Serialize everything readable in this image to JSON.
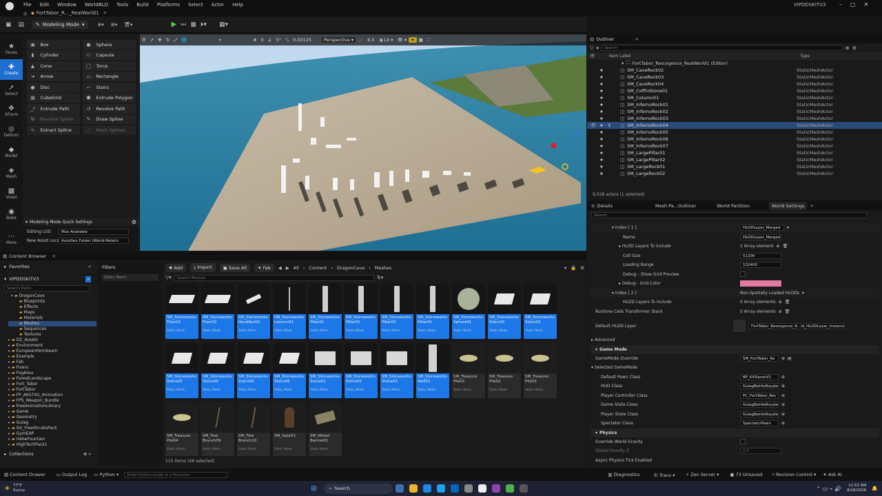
{
  "title_bar": {
    "menus": [
      "File",
      "Edit",
      "Window",
      "WorldBLD",
      "Tools",
      "Build",
      "Platforms",
      "Select",
      "Actor",
      "Help"
    ],
    "tab": "FortTabor_R..._RealWorld1",
    "project": "VIPDDSKITV3"
  },
  "toolbar": {
    "mode": "Modeling Mode"
  },
  "left_icons": [
    {
      "label": "Faves",
      "icon": "star-icon"
    },
    {
      "label": "Create",
      "icon": "plus-icon"
    },
    {
      "label": "Select",
      "icon": "cursor-icon"
    },
    {
      "label": "XForm",
      "icon": "transform-icon"
    },
    {
      "label": "Deform",
      "icon": "deform-icon"
    },
    {
      "label": "Model",
      "icon": "cube-icon"
    },
    {
      "label": "Mesh",
      "icon": "mesh-icon"
    },
    {
      "label": "Voxel",
      "icon": "voxel-icon"
    },
    {
      "label": "Bake",
      "icon": "bake-icon"
    },
    {
      "label": "More",
      "icon": "more-icon"
    }
  ],
  "tools_left": [
    "Box",
    "Cylinder",
    "Cone",
    "Arrow",
    "Disc",
    "CubeGrid",
    "Extrude Path",
    "Revolve Spline",
    "Extract Spline"
  ],
  "tools_right": [
    "Sphere",
    "Capsule",
    "Torus",
    "Rectangle",
    "Stairs",
    "Extrude Polygon",
    "Revolve Path",
    "Draw Spline",
    "Mesh Splines"
  ],
  "quick_settings": {
    "title": "Modeling Mode Quick Settings",
    "editing_lod_label": "Editing LOD",
    "editing_lod_value": "Max Available",
    "new_asset_label": "New Asset Locatio",
    "new_asset_value": "AutoGen Folder (World-Relativ"
  },
  "viewport": {
    "perspective": "Perspective",
    "lit": "Lit",
    "snap_value": "0.03125",
    "camera_speed": "6.5",
    "grid": "0",
    "angle": "5°",
    "scale": "1"
  },
  "outliner": {
    "title": "Outliner",
    "search_placeholder": "Search",
    "col_label": "Item Label",
    "col_type": "Type",
    "root": "FortTabor_Resurgence_RealWorld1 (Editor)",
    "items": [
      "SM_CaveRock02",
      "SM_CaveRock03",
      "SM_CaveRock04",
      "SM_CoffinStone01",
      "SM_Column01",
      "SM_InfernoRock01",
      "SM_InfernoRock02",
      "SM_InfernoRock03",
      "SM_InfernoRock04",
      "SM_InfernoRock05",
      "SM_InfernoRock06",
      "SM_InfernoRock07",
      "SM_LargePillar01",
      "SM_LargePillar02",
      "SM_LargeRock01",
      "SM_LargeRock02"
    ],
    "item_type": "StaticMeshActor",
    "status": "9,028 actors (1 selected)"
  },
  "details": {
    "tabs": [
      "Details",
      "Mesh Pa...Outliner",
      "World Partition",
      "World Settings"
    ],
    "search_placeholder": "Search",
    "rows": {
      "index1": "Index [ 1 ]",
      "index1_val": "HLODLayer_Merged",
      "name": "Name",
      "name_val": "HLODLayer_Merged",
      "hlod_layers": "HLOD Layers To Include",
      "hlod_layers_val": "1 Array element",
      "cell_size": "Cell Size",
      "cell_size_val": "51200",
      "loading_range": "Loading Range",
      "loading_range_val": "102400",
      "debug_grid_preview": "Debug - Show Grid Preview",
      "debug_grid_color": "Debug - Grid Color",
      "index2": "Index [ 2 ]",
      "index2_val": "Non-Spatially Loaded HLODs",
      "hlod_layers2": "HLOD Layers To Include",
      "hlod_layers2_val": "0 Array elements",
      "runtime_cells": "Runtime Cells Transformer Stack",
      "runtime_cells_val": "0 Array elements",
      "default_hlod": "Default HLOD Layer",
      "default_hlod_val": "FortTabor_Resurgence_R...ld_HLODLayer_Instanced",
      "advanced": "Advanced",
      "game_mode": "Game Mode",
      "gamemode_override": "GameMode Override",
      "gamemode_override_val": "SM_FortTabor_Re",
      "selected_gamemode": "Selected GameMode",
      "default_pawn": "Default Pawn Class",
      "default_pawn_val": "BP_KillSarahV1",
      "hud_class": "HUD Class",
      "hud_class_val": "GulagBattleRoyale",
      "player_controller": "Player Controller Class",
      "player_controller_val": "PC_FortTabor_Res",
      "game_state": "Game State Class",
      "game_state_val": "GulagBattleRoyale",
      "player_state": "Player State Class",
      "player_state_val": "GulagBattleRoyale",
      "spectator": "Spectator Class",
      "spectator_val": "SpectatorPawn",
      "physics": "Physics",
      "override_gravity": "Override World Gravity",
      "global_gravity": "Global Gravity Z",
      "global_gravity_val": "0.0",
      "async_physics": "Async Physics Tick Enabled"
    },
    "grid_color": "#e07aa0"
  },
  "content_browser": {
    "tab": "Content Browser",
    "favorites": "Favorites",
    "root": "VIPDDSKITV3",
    "search_paths": "Search Paths",
    "filters": "Filters",
    "filter_chip": "Static Mesh",
    "add": "Add",
    "import": "Import",
    "save_all": "Save All",
    "fab": "Fab",
    "breadcrumb": [
      "All",
      "Content",
      "DragonCave",
      "Meshes"
    ],
    "search_placeholder": "Search Meshes",
    "tree": [
      "DragonCave",
      "Blueprints",
      "Effects",
      "Maps",
      "Materials",
      "Meshes",
      "Sequences",
      "Textures",
      "DZ_Assets",
      "Environment",
      "EuropeanHornbeam",
      "Example",
      "Fab",
      "Fixers",
      "FogArea",
      "ForestLandscape",
      "Fort_Taber",
      "FortTabor",
      "FP_AKS74U_Animation",
      "FPS_Weapon_Bundle",
      "FreeAnimationLibrary",
      "Game",
      "Geometry",
      "Gulag",
      "GV_FreeShrubsPack",
      "GymEAP",
      "HebeFountain",
      "HighTechPack1"
    ],
    "collections": "Collections",
    "assets": [
      {
        "name": "SM_Stoneworks Floor01",
        "type": "Static Mesh"
      },
      {
        "name": "SM_Stoneworks Floor02",
        "type": "Static Mesh"
      },
      {
        "name": "SM_Stoneworks HandRail01",
        "type": "Static Mesh"
      },
      {
        "name": "SM_Stoneworks Lantern01",
        "type": "Static Mesh"
      },
      {
        "name": "SM_Stoneworks Pillar01",
        "type": "Static Mesh"
      },
      {
        "name": "SM_Stoneworks Pillar02",
        "type": "Static Mesh"
      },
      {
        "name": "SM_Stoneworks Pillar03",
        "type": "Static Mesh"
      },
      {
        "name": "SM_Stoneworks Pillar04",
        "type": "Static Mesh"
      },
      {
        "name": "SM_Stoneworks Sphere01",
        "type": "Static Mesh"
      },
      {
        "name": "SM_Stoneworks Stairs01",
        "type": "Static Mesh"
      },
      {
        "name": "SM_Stoneworks Stairs02",
        "type": "Static Mesh"
      },
      {
        "name": "SM_Stoneworks Stairs03",
        "type": "Static Mesh"
      },
      {
        "name": "SM_Stoneworks Stairs04",
        "type": "Static Mesh"
      },
      {
        "name": "SM_Stoneworks Stairs05",
        "type": "Static Mesh"
      },
      {
        "name": "SM_Stoneworks Stairs06",
        "type": "Static Mesh"
      },
      {
        "name": "SM_Stoneworks Stone01",
        "type": "Static Mesh"
      },
      {
        "name": "SM_Stoneworks Stone02",
        "type": "Static Mesh"
      },
      {
        "name": "SM_Stoneworks Stone03",
        "type": "Static Mesh"
      },
      {
        "name": "SM_Stoneworks Wall01",
        "type": "Static Mesh"
      },
      {
        "name": "SM_Treasure Pile01",
        "type": "Static Mesh"
      },
      {
        "name": "SM_Treasure Pile02",
        "type": "Static Mesh"
      },
      {
        "name": "SM_Treasure Pile03",
        "type": "Static Mesh"
      },
      {
        "name": "SM_Treasure Pile04",
        "type": "Static Mesh"
      },
      {
        "name": "SM_Tree Branch09",
        "type": "Static Mesh"
      },
      {
        "name": "SM_Tree Branch10",
        "type": "Static Mesh"
      },
      {
        "name": "SM_Vase01",
        "type": "Static Mesh"
      },
      {
        "name": "SM_Wheel Barrow01",
        "type": "Static Mesh"
      }
    ],
    "status": "115 items (48 selected)"
  },
  "bottom_bar": {
    "content_drawer": "Content Drawer",
    "output_log": "Output Log",
    "python": "Python",
    "cmd_placeholder": "Enter Python script or a filename",
    "diagnostics": "Diagnostics",
    "trace": "Trace",
    "zen": "Zen Server",
    "unsaved": "73 Unsaved",
    "revision": "Revision Control",
    "ask": "Ask AI"
  },
  "taskbar": {
    "temp": "77°F",
    "weather": "Sunny",
    "search": "Search",
    "time": "11:52 AM",
    "date": "8/16/2026"
  }
}
